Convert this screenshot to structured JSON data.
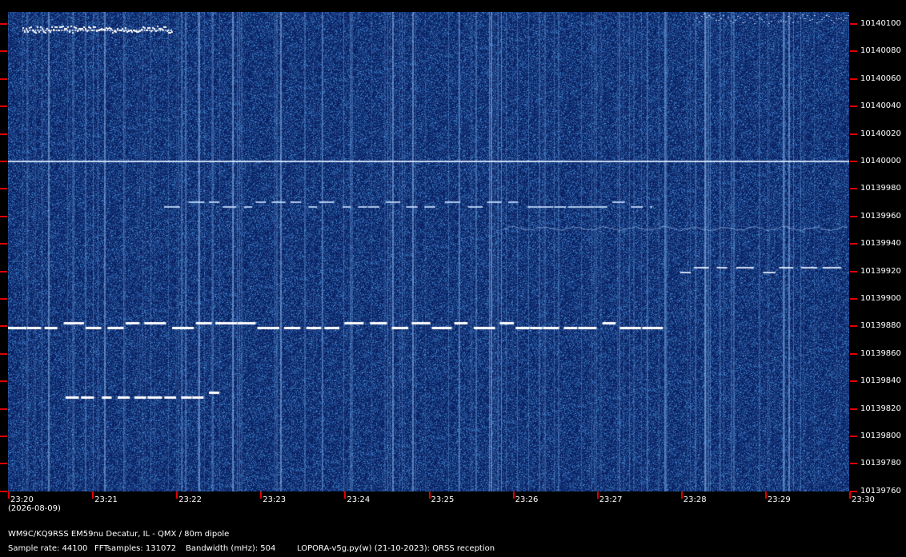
{
  "frequency_labels": [
    "10140100",
    "10140080",
    "10140060",
    "10140040",
    "10140020",
    "10140000",
    "10139980",
    "10139960",
    "10139940",
    "10139920",
    "10139900",
    "10139880",
    "10139860",
    "10139840",
    "10139820",
    "10139800",
    "10139780",
    "10139760"
  ],
  "time_labels": [
    "23:20",
    "23:21",
    "23:22",
    "23:23",
    "23:24",
    "23:25",
    "23:26",
    "23:27",
    "23:28",
    "23:29",
    "23:30"
  ],
  "date_label": "(2026-08-09)",
  "station": "WM9C/KQ9RSS EM59nu Decatur, IL - QMX / 80m dipole",
  "sample_rate": "Sample rate: 44100",
  "fft_samples": "FFTsamples: 131072",
  "bandwidth": "Bandwidth (mHz): 504",
  "software": "LOPORA-v5g.py(w) (21-10-2023): QRSS reception",
  "colors": {
    "background": "#000000",
    "waterfall": "#0a2a78",
    "tick": "#e00000",
    "text": "#ffffff"
  }
}
